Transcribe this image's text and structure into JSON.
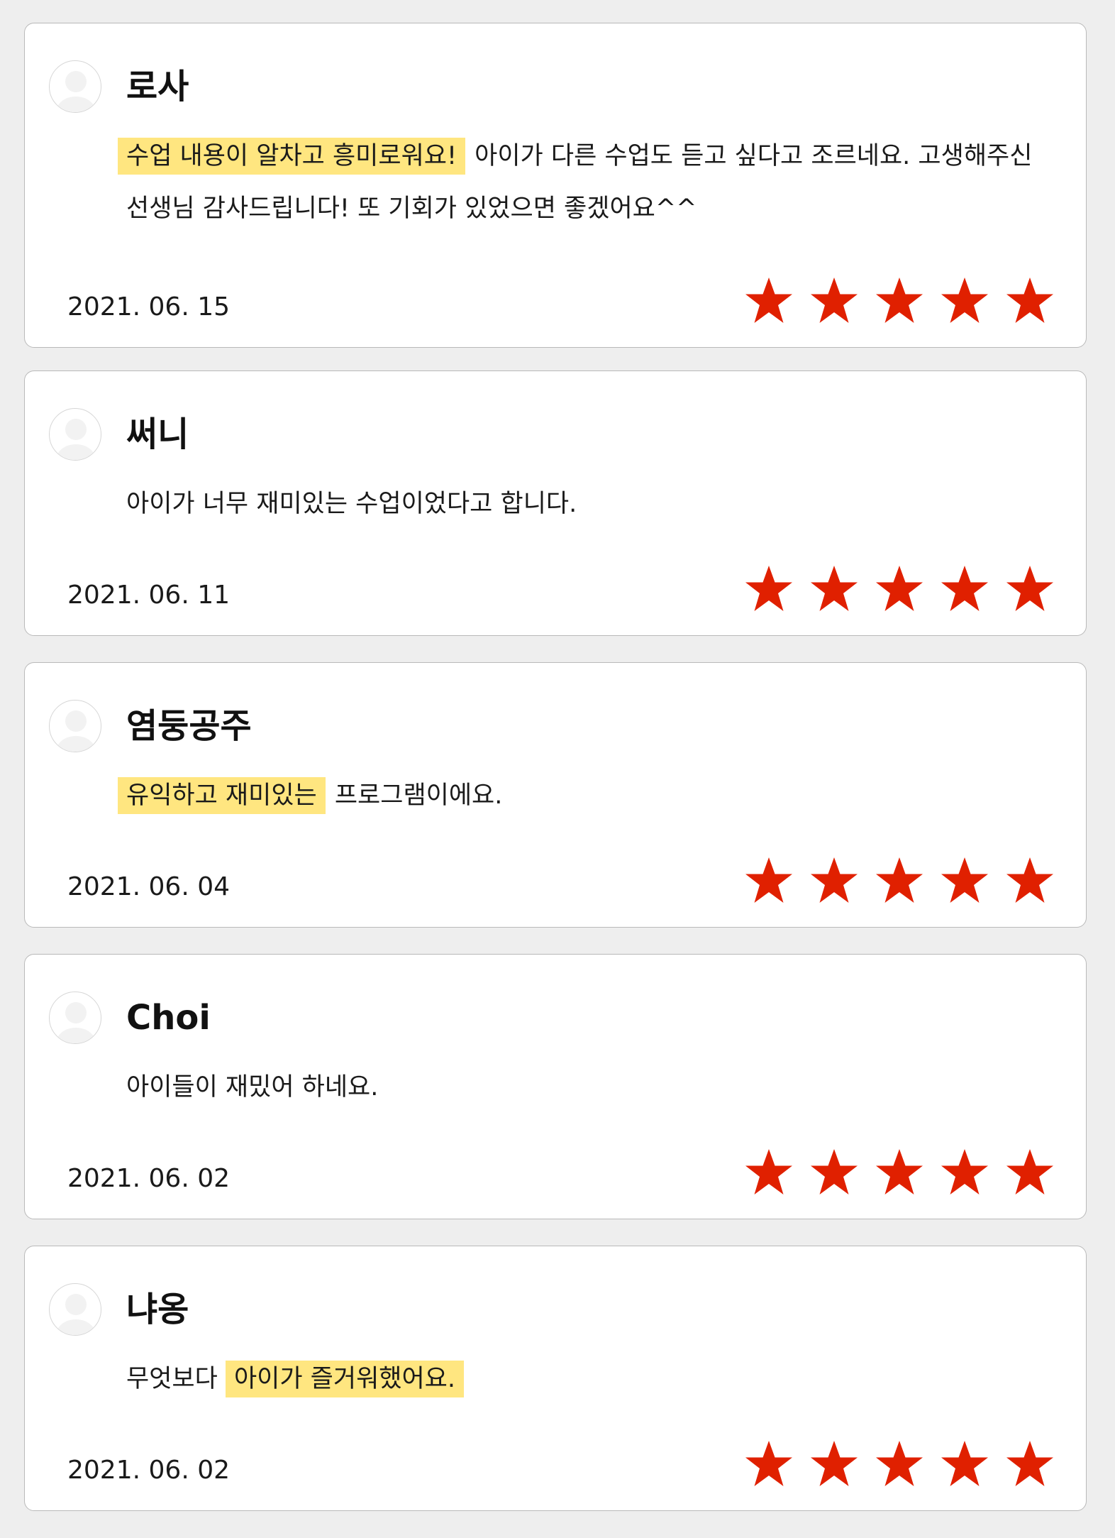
{
  "colors": {
    "background": "#eeeeee",
    "card": "#ffffff",
    "highlight": "#ffe680",
    "star": "#e02000"
  },
  "reviews": [
    {
      "author": "로사",
      "text_highlight": "수업 내용이 알차고 흥미로워요!",
      "text_rest": " 아이가 다른 수업도 듣고 싶다고 조르네요. 고생해주신 선생님 감사드립니다! 또 기회가 있었으면 좋겠어요^^",
      "date": "2021. 06. 15",
      "rating": 5,
      "avatar_icon": "default-user-avatar-icon"
    },
    {
      "author": "써니",
      "text": "아이가 너무 재미있는 수업이었다고 합니다.",
      "date": "2021. 06. 11",
      "rating": 5,
      "avatar_icon": "default-user-avatar-icon"
    },
    {
      "author": "염둥공주",
      "text_highlight": "유익하고 재미있는",
      "text_rest": " 프로그램이에요.",
      "date": "2021. 06. 04",
      "rating": 5,
      "avatar_icon": "default-user-avatar-icon"
    },
    {
      "author": "Choi",
      "text": "아이들이 재밌어 하네요.",
      "date": "2021. 06. 02",
      "rating": 5,
      "avatar_icon": "default-user-avatar-icon"
    },
    {
      "author": "냐옹",
      "text_before": "무엇보다 ",
      "text_highlight": "아이가 즐거워했어요.",
      "date": "2021. 06. 02",
      "rating": 5,
      "avatar_icon": "default-user-avatar-icon"
    }
  ]
}
